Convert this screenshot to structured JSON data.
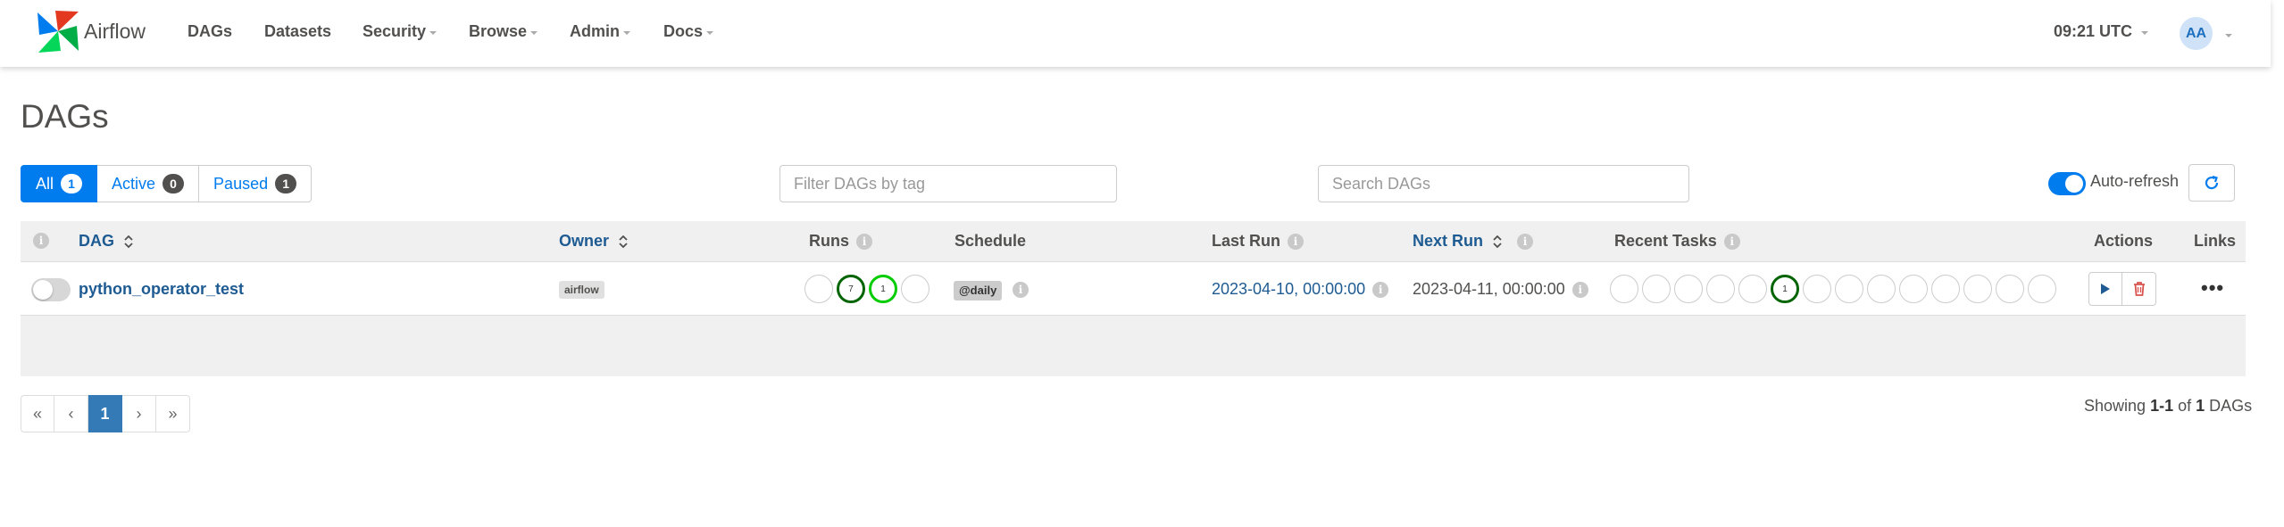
{
  "navbar": {
    "brand": "Airflow",
    "items": [
      {
        "label": "DAGs",
        "dropdown": false
      },
      {
        "label": "Datasets",
        "dropdown": false
      },
      {
        "label": "Security",
        "dropdown": true
      },
      {
        "label": "Browse",
        "dropdown": true
      },
      {
        "label": "Admin",
        "dropdown": true
      },
      {
        "label": "Docs",
        "dropdown": true
      }
    ],
    "clock": "09:21 UTC",
    "avatar": "AA"
  },
  "page_title": "DAGs",
  "status_filter": {
    "all": {
      "label": "All",
      "count": "1"
    },
    "active": {
      "label": "Active",
      "count": "0"
    },
    "paused": {
      "label": "Paused",
      "count": "1"
    }
  },
  "tag_filter": {
    "placeholder": "Filter DAGs by tag"
  },
  "search": {
    "placeholder": "Search DAGs"
  },
  "auto_refresh": {
    "label": "Auto-refresh",
    "enabled": true
  },
  "table": {
    "columns": {
      "dag": "DAG",
      "owner": "Owner",
      "runs": "Runs",
      "schedule": "Schedule",
      "last_run": "Last Run",
      "next_run": "Next Run",
      "recent_tasks": "Recent Tasks",
      "actions": "Actions",
      "links": "Links"
    },
    "rows": [
      {
        "paused": true,
        "dag_id": "python_operator_test",
        "owner": "airflow",
        "runs": [
          {
            "state": "queued",
            "count": ""
          },
          {
            "state": "success",
            "count": "7"
          },
          {
            "state": "running",
            "count": "1"
          },
          {
            "state": "failed",
            "count": ""
          }
        ],
        "schedule": "@daily",
        "last_run": "2023-04-10, 00:00:00",
        "next_run": "2023-04-11, 00:00:00",
        "recent_tasks": [
          {
            "state": "none",
            "count": ""
          },
          {
            "state": "none",
            "count": ""
          },
          {
            "state": "none",
            "count": ""
          },
          {
            "state": "none",
            "count": ""
          },
          {
            "state": "none",
            "count": ""
          },
          {
            "state": "success",
            "count": "1"
          },
          {
            "state": "none",
            "count": ""
          },
          {
            "state": "none",
            "count": ""
          },
          {
            "state": "none",
            "count": ""
          },
          {
            "state": "none",
            "count": ""
          },
          {
            "state": "none",
            "count": ""
          },
          {
            "state": "none",
            "count": ""
          },
          {
            "state": "none",
            "count": ""
          },
          {
            "state": "none",
            "count": ""
          }
        ]
      }
    ]
  },
  "pagination": {
    "first": "«",
    "prev": "‹",
    "current": "1",
    "next": "›",
    "last": "»"
  },
  "showing": {
    "prefix": "Showing",
    "range": "1-1",
    "of": "of",
    "total": "1",
    "suffix": "DAGs"
  },
  "colors": {
    "primary": "#017cee",
    "link": "#1e5b92",
    "success": "#006400",
    "running": "#00cc00",
    "delete": "#d9534f"
  }
}
